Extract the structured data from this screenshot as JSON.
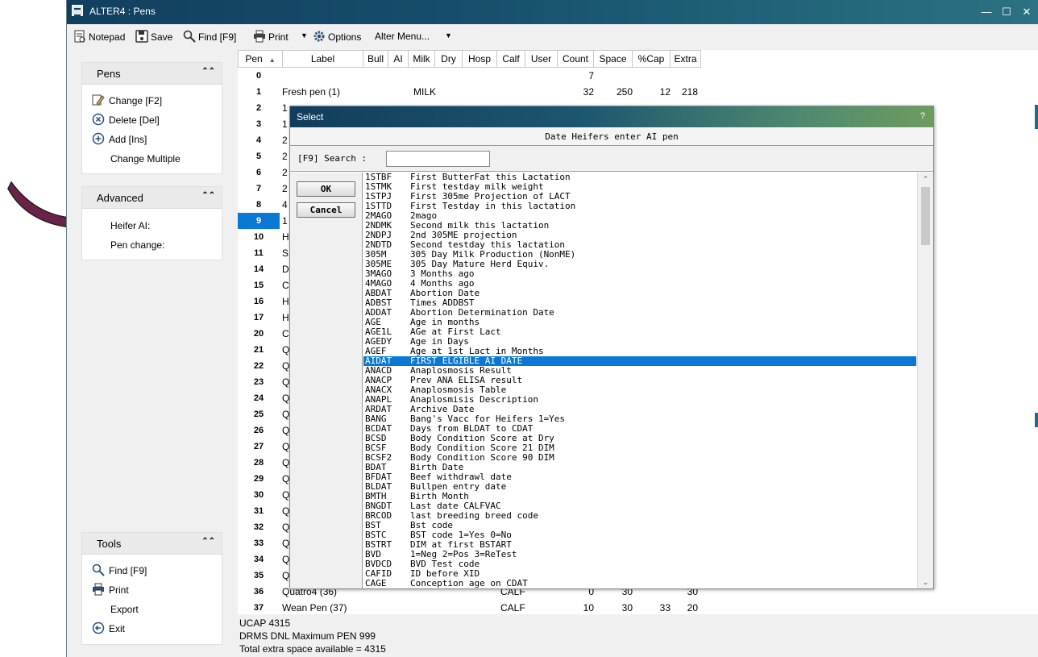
{
  "window": {
    "title": "ALTER4 : Pens",
    "minimize": "—",
    "maximize": "☐",
    "close": "✕"
  },
  "toolbar": {
    "notepad": "Notepad",
    "save": "Save",
    "find": "Find [F9]",
    "print": "Print",
    "options": "Options",
    "alter_menu": "Alter Menu..."
  },
  "sidebar": {
    "pens": {
      "header": "Pens",
      "items": [
        "Change [F2]",
        "Delete [Del]",
        "Add [Ins]",
        "Change Multiple"
      ]
    },
    "advanced": {
      "header": "Advanced",
      "items": [
        "Heifer AI:",
        "Pen change:"
      ]
    },
    "tools": {
      "header": "Tools",
      "items": [
        "Find [F9]",
        "Print",
        "Export",
        "Exit"
      ]
    }
  },
  "grid": {
    "columns": [
      "Pen",
      "Label",
      "Bull",
      "AI",
      "Milk",
      "Dry",
      "Hosp",
      "Calf",
      "User",
      "Count",
      "Space",
      "%Cap",
      "Extra"
    ],
    "sort_indicator": "▲",
    "rows": [
      {
        "pen": "0",
        "label": "",
        "type": "",
        "count": "7",
        "space": "",
        "cap": "",
        "extra": ""
      },
      {
        "pen": "1",
        "label": "Fresh pen   (1)",
        "type": "MILK",
        "count": "32",
        "space": "250",
        "cap": "12",
        "extra": "218"
      },
      {
        "pen": "2",
        "label": "1"
      },
      {
        "pen": "3",
        "label": "1"
      },
      {
        "pen": "4",
        "label": "2"
      },
      {
        "pen": "5",
        "label": "2"
      },
      {
        "pen": "6",
        "label": "2"
      },
      {
        "pen": "7",
        "label": "2"
      },
      {
        "pen": "8",
        "label": "4"
      },
      {
        "pen": "9",
        "label": "1"
      },
      {
        "pen": "10",
        "label": "H"
      },
      {
        "pen": "11",
        "label": "S"
      },
      {
        "pen": "14",
        "label": "D"
      },
      {
        "pen": "15",
        "label": "C"
      },
      {
        "pen": "16",
        "label": "H"
      },
      {
        "pen": "17",
        "label": "H"
      },
      {
        "pen": "20",
        "label": "C"
      },
      {
        "pen": "21",
        "label": "Q"
      },
      {
        "pen": "22",
        "label": "Q"
      },
      {
        "pen": "23",
        "label": "Q"
      },
      {
        "pen": "24",
        "label": "Q"
      },
      {
        "pen": "25",
        "label": "Q"
      },
      {
        "pen": "26",
        "label": "Q"
      },
      {
        "pen": "27",
        "label": "Q"
      },
      {
        "pen": "28",
        "label": "Q"
      },
      {
        "pen": "29",
        "label": "Q"
      },
      {
        "pen": "30",
        "label": "Q"
      },
      {
        "pen": "31",
        "label": "Q"
      },
      {
        "pen": "32",
        "label": "Q"
      },
      {
        "pen": "33",
        "label": "Q"
      },
      {
        "pen": "34",
        "label": "Q"
      },
      {
        "pen": "35",
        "label": "Q"
      },
      {
        "pen": "36",
        "label": "Quatro4    (36)",
        "type": "CALF",
        "count": "0",
        "space": "30",
        "cap": "",
        "extra": "30"
      },
      {
        "pen": "37",
        "label": "Wean Pen   (37)",
        "type": "CALF",
        "count": "10",
        "space": "30",
        "cap": "33",
        "extra": "20"
      }
    ],
    "selected_pen": "9"
  },
  "status": {
    "line1": "UCAP 4315",
    "line2": "DRMS DNL Maximum PEN 999",
    "line3": "Total extra space available = 4315"
  },
  "dialog": {
    "title": "Select",
    "help": "?",
    "subtitle": "Date Heifers enter AI pen",
    "search_label": "[F9] Search :",
    "search_value": "",
    "ok": "OK",
    "cancel": "Cancel",
    "scroll_up": "⌃",
    "scroll_down": "⌄",
    "selected_code": "AIDAT",
    "items": [
      {
        "code": "1STBF",
        "desc": "First ButterFat this Lactation"
      },
      {
        "code": "1STMK",
        "desc": "First testday milk weight"
      },
      {
        "code": "1STPJ",
        "desc": "First 305me Projection of LACT"
      },
      {
        "code": "1STTD",
        "desc": "First Testday in this lactation"
      },
      {
        "code": "2MAGO",
        "desc": "2mago"
      },
      {
        "code": "2NDMK",
        "desc": "Second milk this lactation"
      },
      {
        "code": "2NDPJ",
        "desc": "2nd 305ME projection"
      },
      {
        "code": "2NDTD",
        "desc": "Second testday this lactation"
      },
      {
        "code": "305M",
        "desc": "305 Day Milk Production (NonME)"
      },
      {
        "code": "305ME",
        "desc": "305 Day Mature Herd Equiv."
      },
      {
        "code": "3MAGO",
        "desc": "3 Months ago"
      },
      {
        "code": "4MAGO",
        "desc": "4 Months ago"
      },
      {
        "code": "ABDAT",
        "desc": "Abortion Date"
      },
      {
        "code": "ADBST",
        "desc": "Times ADDBST"
      },
      {
        "code": "ADDAT",
        "desc": "Abortion Determination Date"
      },
      {
        "code": "AGE",
        "desc": "Age in months"
      },
      {
        "code": "AGE1L",
        "desc": "AGe at First Lact"
      },
      {
        "code": "AGEDY",
        "desc": "Age in Days"
      },
      {
        "code": "AGEF",
        "desc": "Age at 1st Lact in Months"
      },
      {
        "code": "AIDAT",
        "desc": "FIRST ELGIBLE AI DATE"
      },
      {
        "code": "ANACD",
        "desc": "Anaplosmosis Result"
      },
      {
        "code": "ANACP",
        "desc": "Prev ANA ELISA result"
      },
      {
        "code": "ANACX",
        "desc": "Anaplosmosis Table"
      },
      {
        "code": "ANAPL",
        "desc": "Anaplosmisis Description"
      },
      {
        "code": "ARDAT",
        "desc": "Archive Date"
      },
      {
        "code": "BANG",
        "desc": "Bang's Vacc for Heifers 1=Yes"
      },
      {
        "code": "BCDAT",
        "desc": "Days from BLDAT to CDAT"
      },
      {
        "code": "BCSD",
        "desc": "Body Condition Score at Dry"
      },
      {
        "code": "BCSF",
        "desc": "Body Condition Score 21 DIM"
      },
      {
        "code": "BCSF2",
        "desc": "Body Condition Score 90 DIM"
      },
      {
        "code": "BDAT",
        "desc": "Birth Date"
      },
      {
        "code": "BFDAT",
        "desc": "Beef withdrawl date"
      },
      {
        "code": "BLDAT",
        "desc": "Bullpen entry date"
      },
      {
        "code": "BMTH",
        "desc": "Birth Month"
      },
      {
        "code": "BNGDT",
        "desc": "Last date CALFVAC"
      },
      {
        "code": "BRCOD",
        "desc": "last breeding breed code"
      },
      {
        "code": "BST",
        "desc": "Bst code"
      },
      {
        "code": "BSTC",
        "desc": "BST code 1=Yes 0=No"
      },
      {
        "code": "BSTRT",
        "desc": "DIM at first BSTART"
      },
      {
        "code": "BVD",
        "desc": "1=Neg 2=Pos 3=ReTest"
      },
      {
        "code": "BVDCD",
        "desc": "BVD Test code"
      },
      {
        "code": "CAFID",
        "desc": "ID before XID"
      },
      {
        "code": "CAGE",
        "desc": "Conception age on CDAT"
      }
    ]
  },
  "colors": {
    "title_bar": "#164d6c",
    "selection": "#0a78d4",
    "arrow": "#6b2248"
  },
  "icons": {
    "notepad": "notepad-icon",
    "save": "save-icon",
    "find": "magnifier-icon",
    "print": "printer-icon",
    "options": "gear-icon",
    "change": "pencil-icon",
    "delete": "delete-circle-icon",
    "add": "add-circle-icon",
    "exit": "exit-circle-icon"
  }
}
